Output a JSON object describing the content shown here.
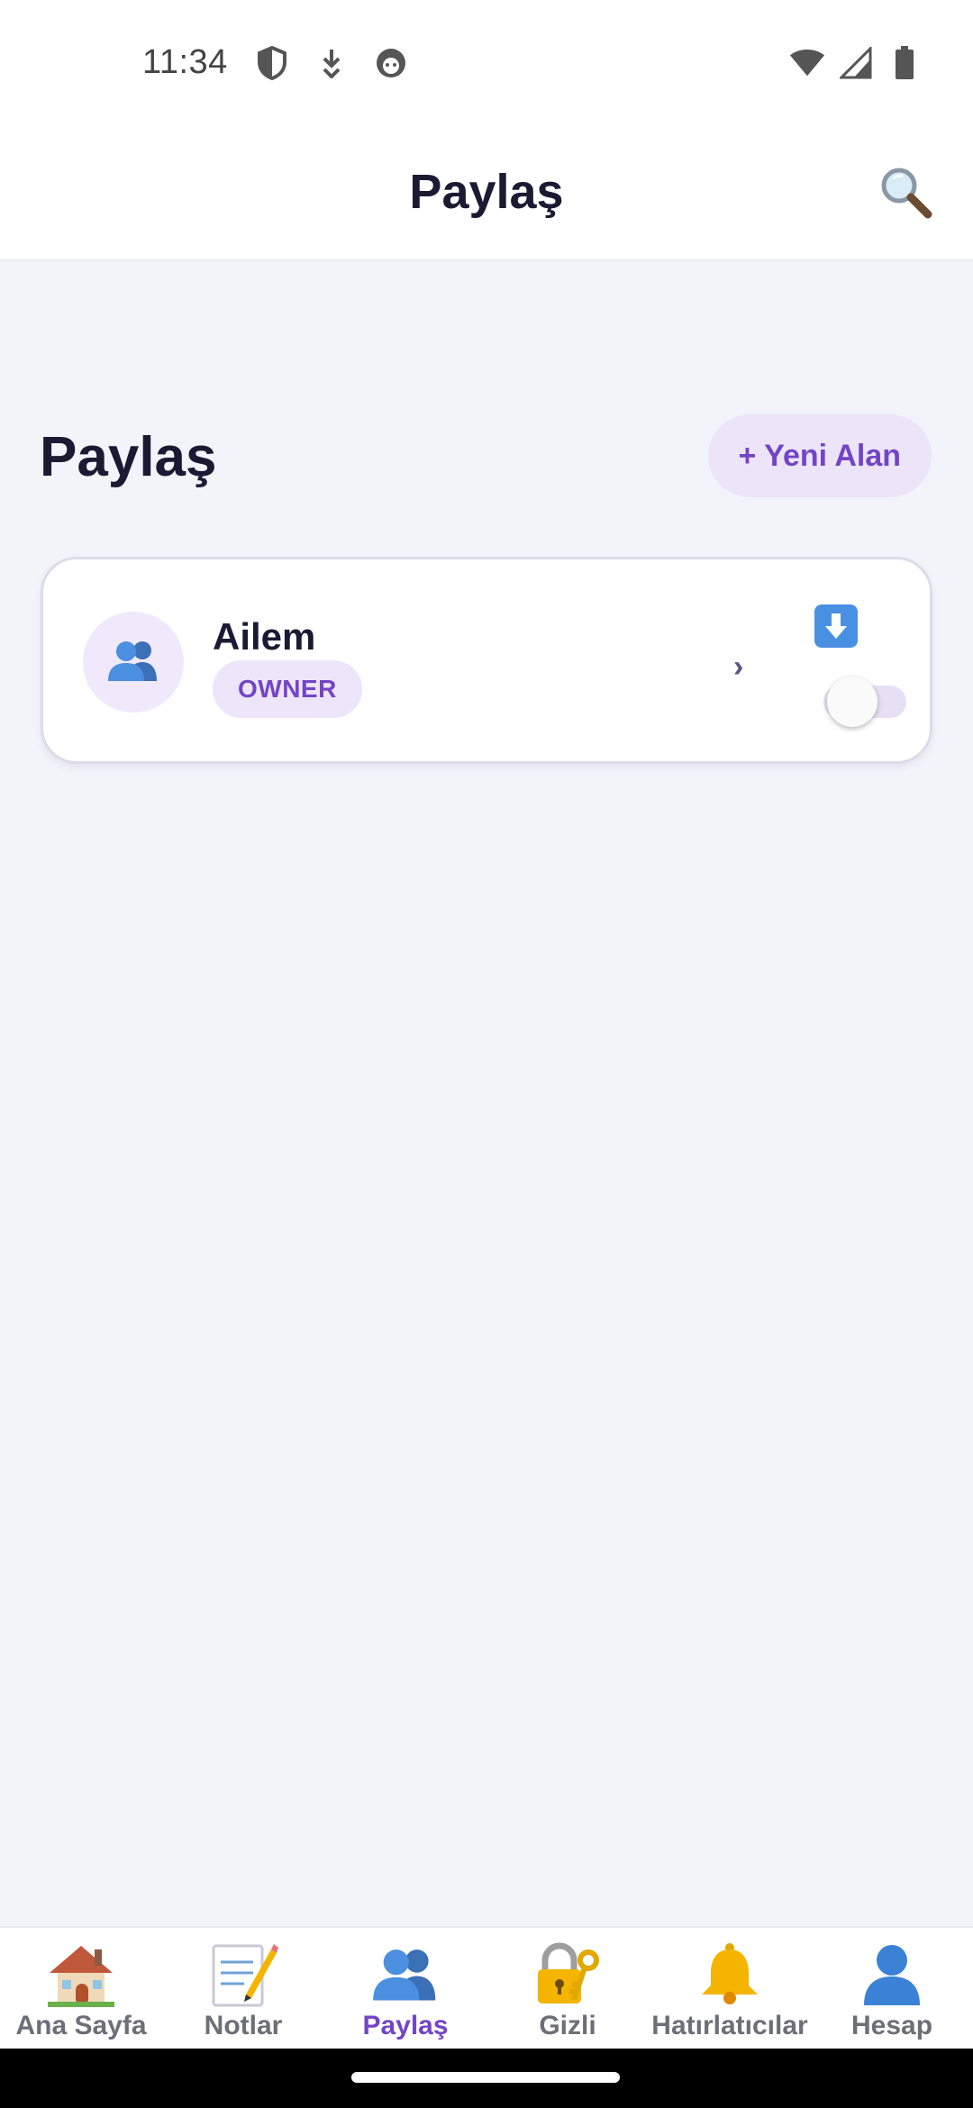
{
  "status_bar": {
    "time": "11:34",
    "left_icons": [
      "shield-icon",
      "download-arrow-icon",
      "face-icon"
    ],
    "right_icons": [
      "wifi-icon",
      "signal-icon",
      "battery-icon"
    ]
  },
  "app_bar": {
    "title": "Paylaş",
    "search_icon": "search-icon"
  },
  "section": {
    "title": "Paylaş",
    "new_area_label": "+ Yeni Alan"
  },
  "spaces": [
    {
      "icon": "people-icon",
      "name": "Ailem",
      "role": "OWNER",
      "chevron": "›",
      "download_icon": "down-arrow-icon",
      "toggle_on": false
    }
  ],
  "bottom_nav": {
    "items": [
      {
        "label": "Ana Sayfa",
        "icon": "house-icon",
        "active": false
      },
      {
        "label": "Notlar",
        "icon": "memo-icon",
        "active": false
      },
      {
        "label": "Paylaş",
        "icon": "people-icon",
        "active": true
      },
      {
        "label": "Gizli",
        "icon": "lock-key-icon",
        "active": false
      },
      {
        "label": "Hatırlatıcılar",
        "icon": "bell-icon",
        "active": false
      },
      {
        "label": "Hesap",
        "icon": "person-icon",
        "active": false
      }
    ]
  },
  "colors": {
    "accent": "#7345c5",
    "background": "#f3f3fa",
    "title": "#1c1a33"
  }
}
